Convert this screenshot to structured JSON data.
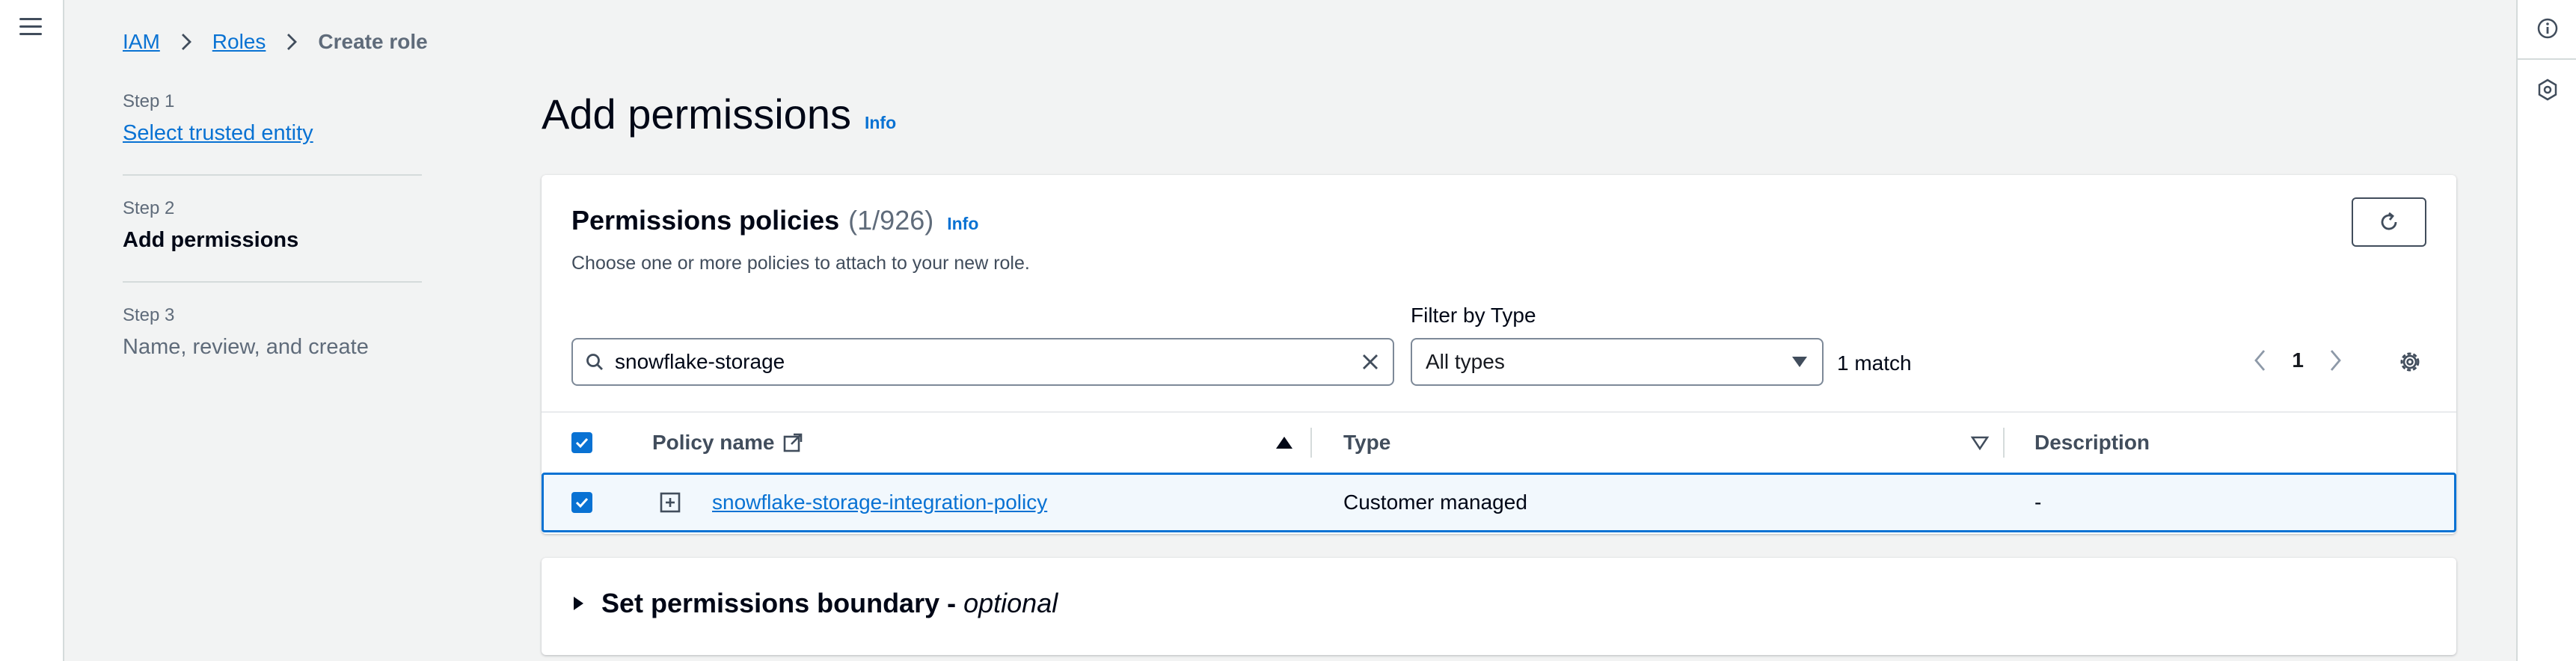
{
  "breadcrumb": {
    "items": [
      "IAM",
      "Roles"
    ],
    "current": "Create role"
  },
  "steps": [
    {
      "number": "Step 1",
      "title": "Select trusted entity"
    },
    {
      "number": "Step 2",
      "title": "Add permissions"
    },
    {
      "number": "Step 3",
      "title": "Name, review, and create"
    }
  ],
  "page": {
    "title": "Add permissions",
    "info": "Info"
  },
  "policies": {
    "title": "Permissions policies",
    "count": "(1/926)",
    "info": "Info",
    "description": "Choose one or more policies to attach to your new role.",
    "filter_label": "Filter by Type",
    "search_value": "snowflake-storage",
    "filter_value": "All types",
    "match_text": "1 match",
    "page_number": "1"
  },
  "table": {
    "columns": [
      "Policy name",
      "Type",
      "Description"
    ],
    "rows": [
      {
        "name": "snowflake-storage-integration-policy",
        "type": "Customer managed",
        "description": "-",
        "selected": true
      }
    ]
  },
  "boundary": {
    "title": "Set permissions boundary -",
    "optional": "optional"
  },
  "colors": {
    "accent": "#0972d3",
    "background": "#f2f3f3",
    "text": "#000716",
    "muted": "#5f6b7a"
  }
}
